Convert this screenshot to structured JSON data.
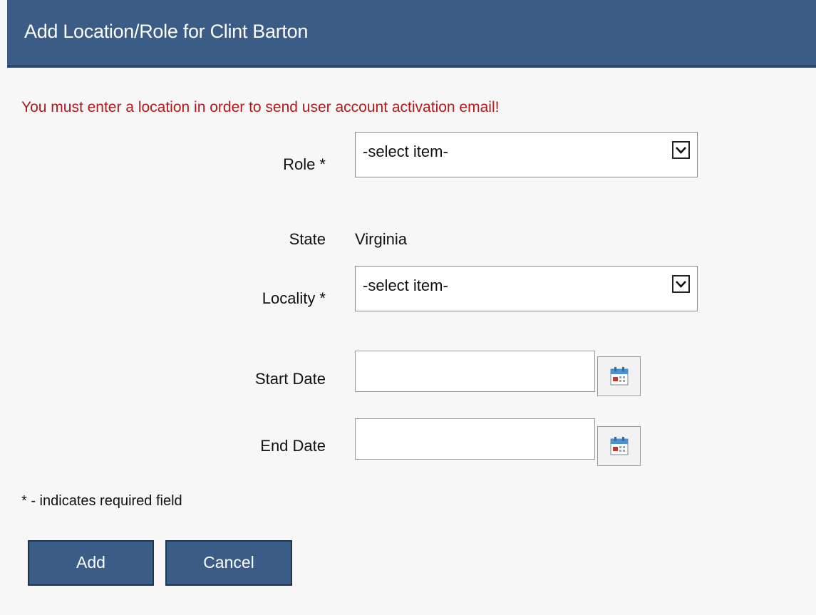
{
  "dialog": {
    "title": "Add Location/Role for Clint Barton"
  },
  "error_message": "You must enter a location in order to send user account activation email!",
  "form": {
    "role": {
      "label": "Role *",
      "selected": "-select item-"
    },
    "state": {
      "label": "State",
      "value": "Virginia"
    },
    "locality": {
      "label": "Locality *",
      "selected": "-select item-"
    },
    "start_date": {
      "label": "Start Date",
      "value": ""
    },
    "end_date": {
      "label": "End Date",
      "value": ""
    }
  },
  "required_note": "* - indicates required field",
  "buttons": {
    "add": "Add",
    "cancel": "Cancel"
  },
  "icons": {
    "dropdown": "chevron-down-icon",
    "calendar": "calendar-icon"
  },
  "colors": {
    "header_bg": "#3a5c86",
    "error_text": "#b21a1a",
    "button_bg": "#3a5c86"
  }
}
